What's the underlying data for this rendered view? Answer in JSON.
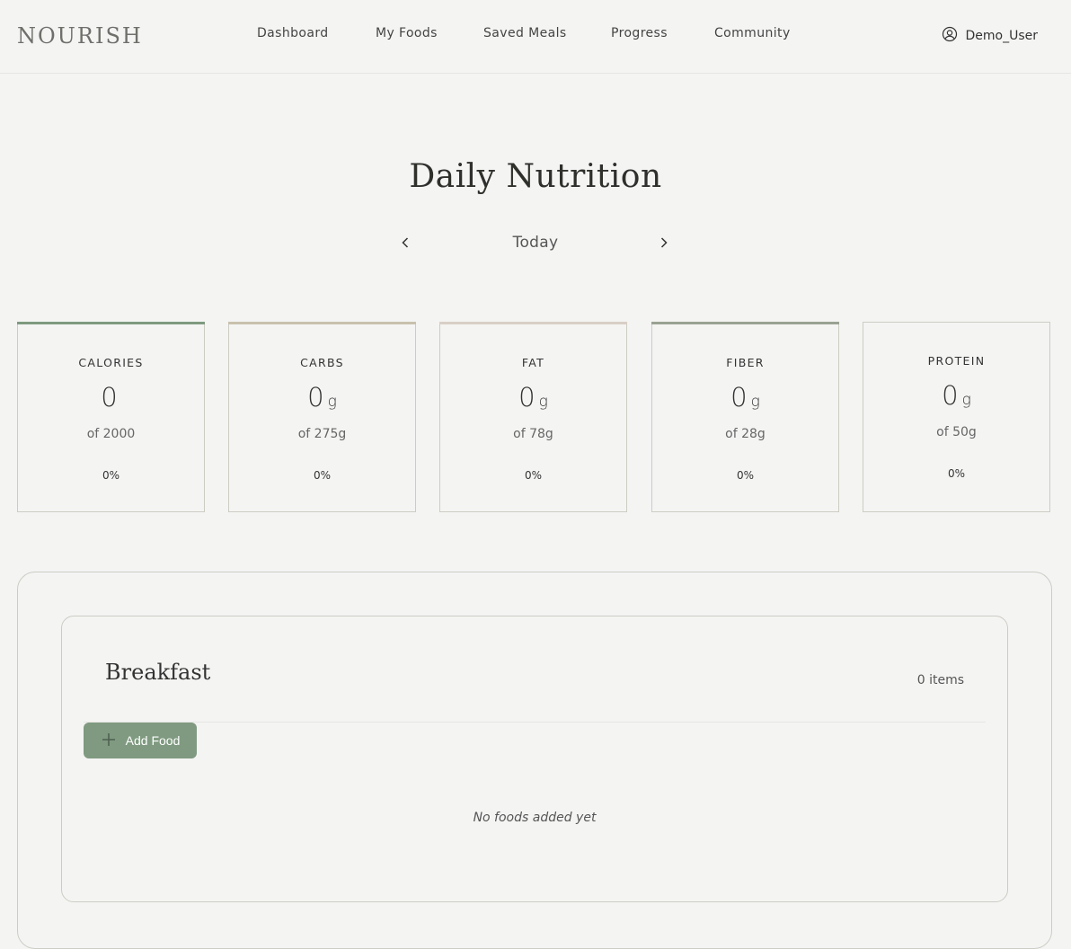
{
  "app": {
    "logo": "NOURISH"
  },
  "nav": [
    {
      "label": "Dashboard"
    },
    {
      "label": "My Foods"
    },
    {
      "label": "Saved Meals"
    },
    {
      "label": "Progress"
    },
    {
      "label": "Community"
    }
  ],
  "user": {
    "name": "Demo_User",
    "icon": "user-circle-icon"
  },
  "page": {
    "title": "Daily Nutrition",
    "date_label": "Today",
    "prev_icon": "chevron-left-icon",
    "next_icon": "chevron-right-icon"
  },
  "nutrients": [
    {
      "name": "CALORIES",
      "value": "0",
      "unit": "",
      "goal": "of 2000",
      "percent": "0%",
      "accent": "#7f9a80"
    },
    {
      "name": "CARBS",
      "value": "0",
      "unit": "g",
      "goal": "of 275g",
      "percent": "0%",
      "accent": "#c9c1ad"
    },
    {
      "name": "FAT",
      "value": "0",
      "unit": "g",
      "goal": "of 78g",
      "percent": "0%",
      "accent": "#d9cfc6"
    },
    {
      "name": "FIBER",
      "value": "0",
      "unit": "g",
      "goal": "of 28g",
      "percent": "0%",
      "accent": "#9aa292"
    },
    {
      "name": "PROTEIN",
      "value": "0",
      "unit": "g",
      "goal": "of 50g",
      "percent": "0%",
      "accent": ""
    }
  ],
  "meal": {
    "title": "Breakfast",
    "count": "0 items",
    "add_label": "Add Food",
    "empty_text": "No foods added yet"
  },
  "colors": {
    "accent_green": "#7f9a80",
    "background": "#f4f4f3",
    "border": "#cdccc4"
  }
}
